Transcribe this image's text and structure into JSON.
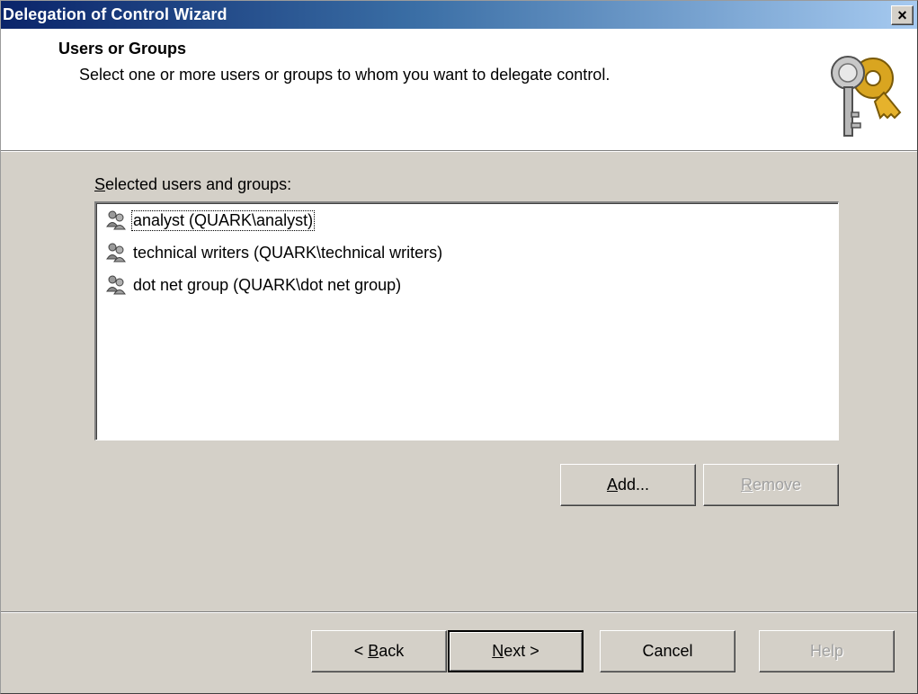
{
  "window": {
    "title": "Delegation of Control Wizard",
    "close_glyph": "×",
    "icon": "keys-icon"
  },
  "header": {
    "title": "Users or Groups",
    "subtitle": "Select one or more users or groups to whom you want to delegate control."
  },
  "list": {
    "label_accel": "S",
    "label_rest": "elected users and groups:",
    "item_icon": "user-group-icon",
    "items": [
      {
        "label": "analyst (QUARK\\analyst)",
        "focused": true
      },
      {
        "label": "technical writers (QUARK\\technical writers)",
        "focused": false
      },
      {
        "label": "dot net group (QUARK\\dot net group)",
        "focused": false
      }
    ]
  },
  "buttons": {
    "add_accel": "A",
    "add_rest": "dd...",
    "remove_accel": "R",
    "remove_rest": "emove",
    "back_prefix": "< ",
    "back_accel": "B",
    "back_rest": "ack",
    "next_accel": "N",
    "next_rest": "ext >",
    "cancel": "Cancel",
    "help": "Help"
  },
  "colors": {
    "dialog_bg": "#d4d0c8",
    "title_gradient_start": "#0a246a",
    "title_gradient_end": "#a6caf0",
    "disabled_text": "#a0a0a0"
  }
}
